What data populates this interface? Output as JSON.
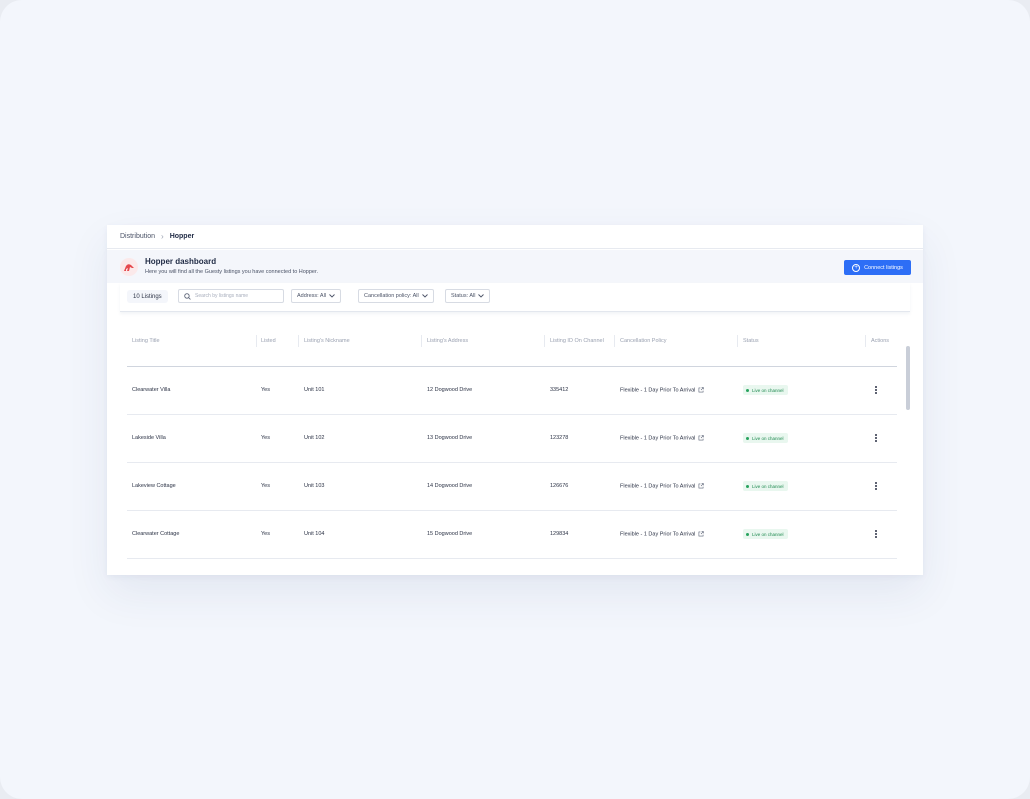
{
  "breadcrumb": {
    "parent": "Distribution",
    "separator": "›",
    "current": "Hopper"
  },
  "header": {
    "title": "Hopper dashboard",
    "subtitle": "Here you will find all the Guesty listings you have connected to Hopper.",
    "connect_button": "Connect listings",
    "logo_icon": "hopper-logo-icon"
  },
  "filters": {
    "count_label": "10 Listings",
    "search_placeholder": "Search by listings name",
    "address": "Address: All",
    "cancellation": "Cancellation policy: All",
    "status": "Status: All"
  },
  "table": {
    "columns": [
      "Listing Title",
      "Listed",
      "Listing's Nickname",
      "Listing's Address",
      "Listing ID On Channel",
      "Cancellation Policy",
      "Status",
      "Actions"
    ],
    "rows": [
      {
        "title": "Clearwater Villa",
        "listed": "Yes",
        "nickname": "Unit 101",
        "address": "12 Dogwood Drive",
        "listing_id": "335412",
        "policy": "Flexible - 1 Day Prior To Arrival",
        "status": "Live on channel"
      },
      {
        "title": "Lakeside Villa",
        "listed": "Yes",
        "nickname": "Unit 102",
        "address": "13 Dogwood Drive",
        "listing_id": "123278",
        "policy": "Flexible - 1 Day Prior To Arrival",
        "status": "Live on channel"
      },
      {
        "title": "Lakeview Cottage",
        "listed": "Yes",
        "nickname": "Unit 103",
        "address": "14 Dogwood Drive",
        "listing_id": "126676",
        "policy": "Flexible - 1 Day Prior To Arrival",
        "status": "Live on channel"
      },
      {
        "title": "Clearwater Cottage",
        "listed": "Yes",
        "nickname": "Unit 104",
        "address": "15 Dogwood Drive",
        "listing_id": "129834",
        "policy": "Flexible - 1 Day Prior To Arrival",
        "status": "Live on channel"
      }
    ]
  },
  "colors": {
    "primary": "#2d6ef6",
    "status_bg": "#e9f7ef",
    "status_text": "#1f8a50"
  }
}
